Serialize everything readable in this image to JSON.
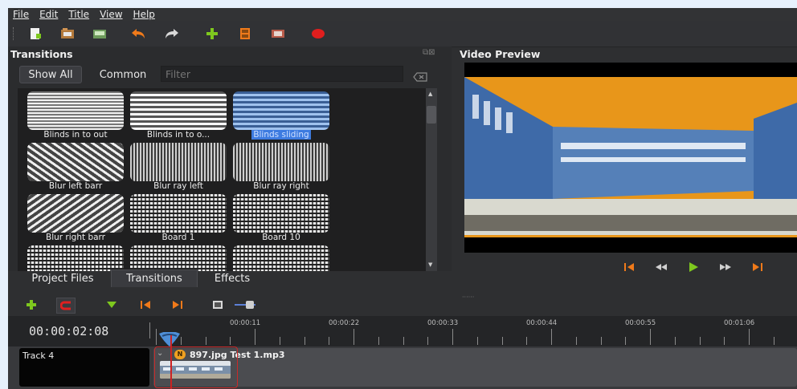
{
  "menu": [
    "File",
    "Edit",
    "Title",
    "View",
    "Help"
  ],
  "panels": {
    "transitions_title": "Transitions",
    "preview_title": "Video Preview"
  },
  "filter": {
    "show_all": "Show All",
    "common": "Common",
    "placeholder": "Filter"
  },
  "transitions": [
    {
      "label": "Blinds in to out",
      "pattern": "hstripes",
      "selected": false
    },
    {
      "label": "Blinds in to o...",
      "pattern": "hstripes2",
      "selected": false
    },
    {
      "label": "Blinds sliding",
      "pattern": "hstripes-blue",
      "selected": true
    },
    {
      "label": "Blur left barr",
      "pattern": "diag",
      "selected": false
    },
    {
      "label": "Blur ray left",
      "pattern": "rays",
      "selected": false
    },
    {
      "label": "Blur ray right",
      "pattern": "rays",
      "selected": false
    },
    {
      "label": "Blur right barr",
      "pattern": "diag2",
      "selected": false
    },
    {
      "label": "Board 1",
      "pattern": "board",
      "selected": false
    },
    {
      "label": "Board 10",
      "pattern": "board",
      "selected": false
    },
    {
      "label": "",
      "pattern": "board",
      "selected": false
    },
    {
      "label": "",
      "pattern": "board",
      "selected": false
    },
    {
      "label": "",
      "pattern": "board",
      "selected": false
    }
  ],
  "tabs": [
    {
      "label": "Project Files",
      "active": false
    },
    {
      "label": "Transitions",
      "active": true
    },
    {
      "label": "Effects",
      "active": false
    }
  ],
  "timeline": {
    "timecode": "00:00:02:08",
    "ticks": [
      "00:00:11",
      "00:00:22",
      "00:00:33",
      "00:00:44",
      "00:00:55",
      "00:01:06"
    ]
  },
  "track": {
    "name": "Track 4",
    "clip_badge": "N",
    "clip_title": "897.jpg",
    "clip_title2": "Test 1.mp3"
  },
  "colors": {
    "accent_orange": "#f07a1a",
    "accent_green": "#7ec81e",
    "selection_blue": "#3d7be0",
    "playhead_red": "#cc2222"
  }
}
